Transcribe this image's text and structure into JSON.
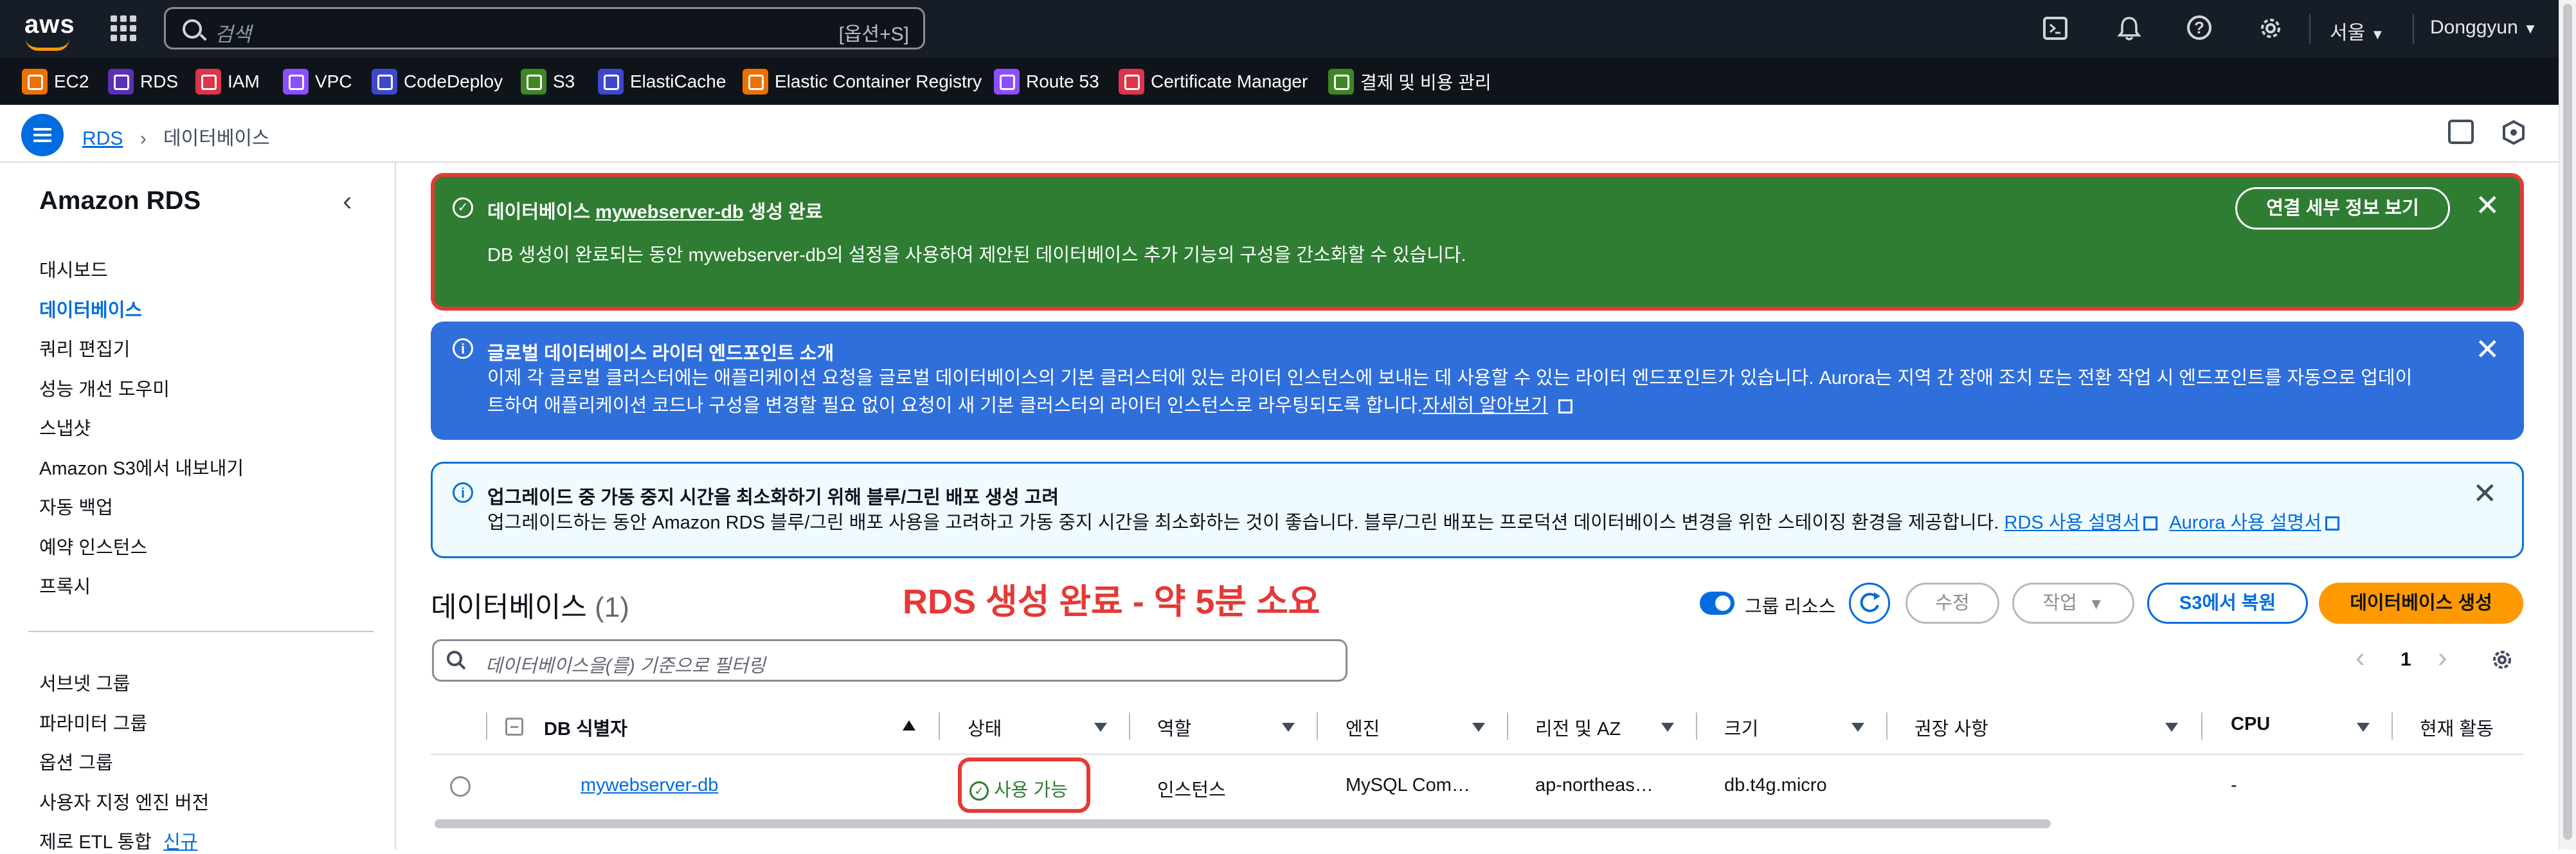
{
  "topnav": {
    "logo": "aws",
    "search_placeholder": "검색",
    "search_shortcut": "[옵션+S]",
    "region": "서울",
    "user": "Donggyun",
    "icons": [
      "cloudshell-icon",
      "bell-icon",
      "help-icon",
      "settings-icon"
    ]
  },
  "services": [
    {
      "label": "EC2",
      "color": "#ed7100"
    },
    {
      "label": "RDS",
      "color": "#5a30b5"
    },
    {
      "label": "IAM",
      "color": "#dd344c"
    },
    {
      "label": "VPC",
      "color": "#8c4fff"
    },
    {
      "label": "CodeDeploy",
      "color": "#3f48cc"
    },
    {
      "label": "S3",
      "color": "#3f8624"
    },
    {
      "label": "ElastiCache",
      "color": "#3f48cc"
    },
    {
      "label": "Elastic Container Registry",
      "color": "#ed7100"
    },
    {
      "label": "Route 53",
      "color": "#8c4fff"
    },
    {
      "label": "Certificate Manager",
      "color": "#dd344c"
    },
    {
      "label": "결제 및 비용 관리",
      "color": "#3f8624"
    }
  ],
  "breadcrumb": {
    "root": "RDS",
    "current": "데이터베이스"
  },
  "sidebar": {
    "title": "Amazon RDS",
    "items": [
      "대시보드",
      "데이터베이스",
      "쿼리 편집기",
      "성능 개선 도우미",
      "스냅샷",
      "Amazon S3에서 내보내기",
      "자동 백업",
      "예약 인스턴스",
      "프록시"
    ],
    "items2": [
      "서브넷 그룹",
      "파라미터 그룹",
      "옵션 그룹",
      "사용자 지정 엔진 버전",
      "제로 ETL 통합"
    ],
    "new_badge": "신규"
  },
  "banner_success": {
    "title_prefix": "데이터베이스",
    "db_name": "mywebserver-db",
    "title_suffix": "생성 완료",
    "body": "DB 생성이 완료되는 동안 mywebserver-db의 설정을 사용하여 제안된 데이터베이스 추가 기능의 구성을 간소화할 수 있습니다.",
    "button": "연결 세부 정보 보기"
  },
  "banner_info1": {
    "title": "글로벌 데이터베이스 라이터 엔드포인트 소개",
    "body1": "이제 각 글로벌 클러스터에는 애플리케이션 요청을 글로벌 데이터베이스의 기본 클러스터에 있는 라이터 인스턴스에 보내는 데 사용할 수 있는 라이터 엔드포인트가 있습니다. Aurora는 지역 간 장애 조치 또는 전환 작업 시 엔드포인트를 자동으로 업데이",
    "body2": "트하여 애플리케이션 코드나 구성을 변경할 필요 없이 요청이 새 기본 클러스터의 라이터 인스턴스로 라우팅되도록 합니다.",
    "link": "자세히 알아보기"
  },
  "banner_info2": {
    "title": "업그레이드 중 가동 중지 시간을 최소화하기 위해 블루/그린 배포 생성 고려",
    "body": "업그레이드하는 동안 Amazon RDS 블루/그린 배포 사용을 고려하고 가동 중지 시간을 최소화하는 것이 좋습니다. 블루/그린 배포는 프로덕션 데이터베이스 변경을 위한 스테이징 환경을 제공합니다.",
    "link1": "RDS 사용 설명서",
    "link2": "Aurora 사용 설명서"
  },
  "annotation": "RDS 생성 완료 - 약 5분 소요",
  "databases": {
    "title": "데이터베이스",
    "count": "(1)",
    "group_toggle": "그룹 리소스",
    "btn_modify": "수정",
    "btn_actions": "작업",
    "btn_restore": "S3에서 복원",
    "btn_create": "데이터베이스 생성",
    "filter_placeholder": "데이터베이스을(를) 기준으로 필터링",
    "page": "1",
    "columns": [
      "DB 식별자",
      "상태",
      "역할",
      "엔진",
      "리전 및 AZ",
      "크기",
      "권장 사항",
      "CPU",
      "현재 활동"
    ],
    "rows": [
      {
        "id": "mywebserver-db",
        "status": "사용 가능",
        "role": "인스턴스",
        "engine": "MySQL Com…",
        "region": "ap-northeas…",
        "size": "db.t4g.micro",
        "recommend": "",
        "cpu": "-",
        "activity": ""
      }
    ]
  },
  "colors": {
    "success": "#2e7d32",
    "info": "#2f6fdc",
    "highlight": "#e53935",
    "accent": "#006ce0",
    "orange": "#ff9900"
  }
}
